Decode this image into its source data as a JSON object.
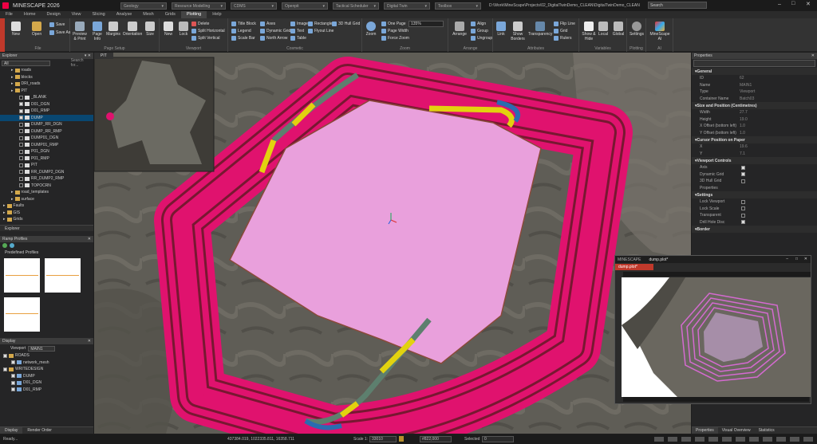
{
  "app": {
    "title": "MINESCAPE 2026",
    "path": "D:\\Work\\MineScape\\Projects\\02_DigitalTwinDemo_CLEAN\\DigitalTwinDemo_CLEAN",
    "search": "Search"
  },
  "title_combos": [
    "Geology",
    "Resource Modelling",
    "CDMS",
    "Openpit",
    "Tactical Scheduler",
    "Digital Twin",
    "Toolbox"
  ],
  "menus": [
    "File",
    "Home",
    "Design",
    "View",
    "Slicing",
    "Analyse",
    "Mesh",
    "Grids",
    "Plotting",
    "Help"
  ],
  "ribbon": {
    "file": {
      "label": "File",
      "new": "New",
      "open": "Open",
      "save": "Save",
      "save_as": "Save As"
    },
    "page_setup": {
      "label": "Page Setup",
      "preview": "Preview & Print",
      "page_info": "Page Info",
      "margins": "Margins",
      "orientation": "Orientation",
      "size": "Size"
    },
    "viewport": {
      "label": "Viewport",
      "new": "New",
      "lock": "Lock",
      "delete": "Delete",
      "split_h": "Split Horizontal",
      "split_v": "Split Vertical"
    },
    "cosmetic": {
      "label": "Cosmetic",
      "title_block": "Title Block",
      "legend": "Legend",
      "scale_bar": "Scale Bar",
      "axes": "Axes",
      "dyn_grid": "Dynamic Grid",
      "north": "North Arrow",
      "image": "Image",
      "text": "Text",
      "table": "Table",
      "rectangle": "Rectangle",
      "flyout": "Flyout Line",
      "hull": "3D Hull Grid"
    },
    "zoom": {
      "label": "Zoom",
      "zoom": "Zoom",
      "one_page": "One Page",
      "page_width": "Page Width",
      "force": "Force Zoom",
      "level": "135%"
    },
    "arrange": {
      "label": "Arrange",
      "arrange": "Arrange",
      "align": "Align",
      "group": "Group",
      "ungroup": "Ungroup"
    },
    "attributes": {
      "label": "Attributes",
      "link": "Link",
      "borders": "Show Borders",
      "transparency": "Transparency",
      "flip": "Flip Line",
      "grid": "Grid",
      "rulers": "Rulers"
    },
    "variables": {
      "label": "Variables",
      "show": "Show & Hide",
      "local": "Local",
      "global": "Global"
    },
    "plotting": {
      "label": "Plotting",
      "settings": "Settings"
    },
    "ai": {
      "label": "AI",
      "minescape": "MineScape AI"
    }
  },
  "explorer": {
    "title": "Explorer",
    "filter": "All",
    "search": "Search for...",
    "items": [
      {
        "label": "roads",
        "indent": 1,
        "type": "folder"
      },
      {
        "label": "blocks",
        "indent": 1,
        "type": "folder"
      },
      {
        "label": "DRI_roads",
        "indent": 1,
        "type": "folder"
      },
      {
        "label": "PIT",
        "indent": 1,
        "type": "folder"
      },
      {
        "label": "_BLANK",
        "indent": 2,
        "type": "item",
        "checked": false
      },
      {
        "label": "D01_DGN",
        "indent": 2,
        "type": "item",
        "checked": true
      },
      {
        "label": "D01_RMP",
        "indent": 2,
        "type": "item",
        "checked": true
      },
      {
        "label": "DUMP",
        "indent": 2,
        "type": "item",
        "checked": true,
        "selected": true
      },
      {
        "label": "DUMP_RR_DGN",
        "indent": 2,
        "type": "item",
        "checked": false
      },
      {
        "label": "DUMP_RR_RMP",
        "indent": 2,
        "type": "item",
        "checked": false
      },
      {
        "label": "DUMP01_DGN",
        "indent": 2,
        "type": "item",
        "checked": false
      },
      {
        "label": "DUMP01_RMP",
        "indent": 2,
        "type": "item",
        "checked": false
      },
      {
        "label": "P01_DGN",
        "indent": 2,
        "type": "item",
        "checked": false
      },
      {
        "label": "P01_RMP",
        "indent": 2,
        "type": "item",
        "checked": false
      },
      {
        "label": "PIT",
        "indent": 2,
        "type": "item",
        "checked": false
      },
      {
        "label": "RR_DUMP2_DGN",
        "indent": 2,
        "type": "item",
        "checked": false
      },
      {
        "label": "RR_DUMP2_RMP",
        "indent": 2,
        "type": "item",
        "checked": false
      },
      {
        "label": "TOPOCRN",
        "indent": 2,
        "type": "item",
        "checked": false
      },
      {
        "label": "road_templates",
        "indent": 1,
        "type": "folder"
      },
      {
        "label": "surface",
        "indent": 1,
        "type": "folder"
      },
      {
        "label": "Faults",
        "indent": 0,
        "type": "folder"
      },
      {
        "label": "GIS",
        "indent": 0,
        "type": "folder"
      },
      {
        "label": "Grids",
        "indent": 0,
        "type": "folder"
      }
    ],
    "tab": "Explorer"
  },
  "ramp": {
    "title": "Ramp Profiles",
    "section": "Predefined Profiles"
  },
  "display": {
    "title": "Display",
    "viewport_label": "Viewport",
    "viewport_value": "MAIN1",
    "items": [
      {
        "label": "ROADS",
        "indent": 0
      },
      {
        "label": "network_mesh",
        "indent": 1
      },
      {
        "label": "WRITEDESIGN",
        "indent": 0
      },
      {
        "label": "DUMP",
        "indent": 1
      },
      {
        "label": "D01_DGN",
        "indent": 1
      },
      {
        "label": "D01_RMP",
        "indent": 1
      }
    ],
    "tabs": [
      "Display",
      "Render Order"
    ]
  },
  "doc_tab": "PIT",
  "properties": {
    "title": "Properties",
    "sections": [
      {
        "name": "General",
        "rows": [
          [
            "ID",
            "62"
          ],
          [
            "Name",
            "MAIN1"
          ],
          [
            "Type",
            "Viewport"
          ],
          [
            "Container Name",
            "Batch03"
          ]
        ]
      },
      {
        "name": "Size and Position (Centimetres)",
        "rows": [
          [
            "Width",
            "27.7"
          ],
          [
            "Height",
            "19.0"
          ],
          [
            "X Offset (bottom left)",
            "1.0"
          ],
          [
            "Y Offset (bottom left)",
            "1.0"
          ]
        ]
      },
      {
        "name": "Cursor Position on Paper",
        "rows": [
          [
            "X",
            "19.6"
          ],
          [
            "Y",
            "7.1"
          ]
        ]
      },
      {
        "name": "Viewport Controls",
        "rows": [
          [
            "Axis",
            "check"
          ],
          [
            "Dynamic Grid",
            "check"
          ],
          [
            "3D Hull Grid",
            "box"
          ],
          [
            "Properties",
            ""
          ]
        ]
      },
      {
        "name": "Settings",
        "rows": [
          [
            "Lock Viewport",
            "box"
          ],
          [
            "Lock Scale",
            "box"
          ],
          [
            "Transparent",
            "box"
          ],
          [
            "Drill Hole Disc",
            "check"
          ]
        ]
      },
      {
        "name": "Border",
        "rows": []
      }
    ],
    "tabs": [
      "Properties",
      "Visual Overview",
      "Statistics"
    ]
  },
  "floating": {
    "app": "MINESCAPE",
    "title": "dump.plot*",
    "tab": "dump.plot*"
  },
  "status": {
    "left": "Ready...",
    "coords": "437384.019, 1022335.811, 16358.711",
    "scale_label": "Scale 1:",
    "scale": "33010",
    "rotation": "#822,000",
    "selected_label": "Selected",
    "selected": "0"
  },
  "colors": {
    "accent": "#c0392b",
    "pink_band": "#e0126e",
    "dump_fill": "#e9a0dc",
    "ramp": "#e2d20f",
    "road": "#5d7f6e"
  }
}
